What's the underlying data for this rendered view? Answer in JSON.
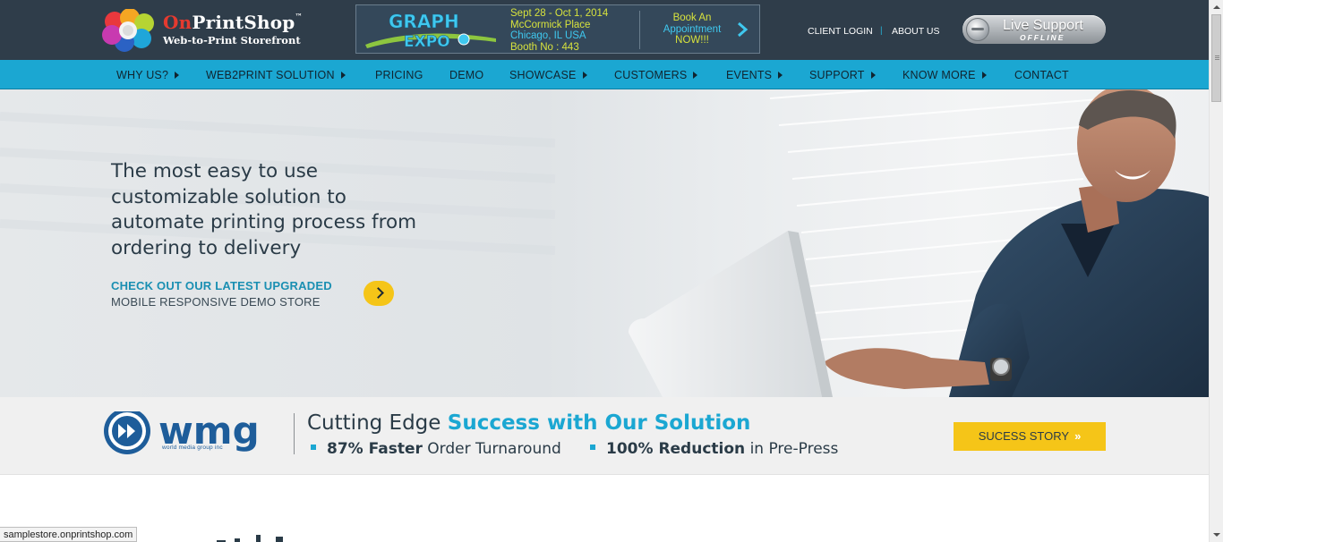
{
  "header": {
    "logo": {
      "name_prefix": "On",
      "name_suffix": "PrintShop",
      "trademark": "™",
      "tagline": "Web-to-Print Storefront"
    },
    "expo": {
      "logo_line1": "GRAPH",
      "logo_line2": "EXPO",
      "dates": "Sept 28 - Oct 1, 2014",
      "venue": "McCormick Place",
      "city": "Chicago, IL USA",
      "booth": "Booth No : 443",
      "cta_line1": "Book An",
      "cta_line2": "Appointment",
      "cta_line3": "NOW!!!"
    },
    "client_login": "CLIENT LOGIN",
    "separator": "|",
    "about_us": "ABOUT US",
    "live_support": {
      "title": "Live Support",
      "status": "OFFLINE"
    }
  },
  "nav": {
    "items": [
      {
        "label": "WHY US?",
        "caret": true
      },
      {
        "label": "WEB2PRINT SOLUTION",
        "caret": true
      },
      {
        "label": "PRICING",
        "caret": false
      },
      {
        "label": "DEMO",
        "caret": false
      },
      {
        "label": "SHOWCASE",
        "caret": true
      },
      {
        "label": "CUSTOMERS",
        "caret": true
      },
      {
        "label": "EVENTS",
        "caret": true
      },
      {
        "label": "SUPPORT",
        "caret": true
      },
      {
        "label": "KNOW MORE",
        "caret": true
      },
      {
        "label": "CONTACT",
        "caret": false
      }
    ]
  },
  "hero": {
    "headline_lines": [
      "The most easy to use",
      "customizable solution to",
      "automate printing process from",
      "ordering to delivery"
    ],
    "cta_line1": "CHECK OUT OUR LATEST UPGRADED",
    "cta_line2": "MOBILE RESPONSIVE DEMO STORE"
  },
  "strip": {
    "brand": "wmg",
    "brand_sub": "world media group inc",
    "title_plain": "Cutting Edge",
    "title_highlight": "Success with Our Solution",
    "stats": [
      {
        "bold": "87% Faster",
        "rest": "Order Turnaround"
      },
      {
        "bold": "100% Reduction",
        "rest": "in Pre-Press"
      }
    ],
    "button": "SUCESS STORY",
    "button_chevron": "»"
  },
  "status_bar": {
    "url": "samplestore.onprintshop.com"
  },
  "colors": {
    "header_bg": "#2f3d4a",
    "nav_bg": "#1ba7d2",
    "accent_yellow": "#f5c518",
    "brand_red": "#e53a2f",
    "expo_yellow": "#d7e23d"
  },
  "icons": [
    "onprintshop-logo-icon",
    "graph-expo-logo-icon",
    "chevron-right-icon",
    "live-support-icon",
    "caret-right-icon",
    "arrow-right-icon",
    "wmg-logo-icon",
    "bullet-square-icon",
    "scroll-up-icon",
    "scroll-down-icon"
  ]
}
